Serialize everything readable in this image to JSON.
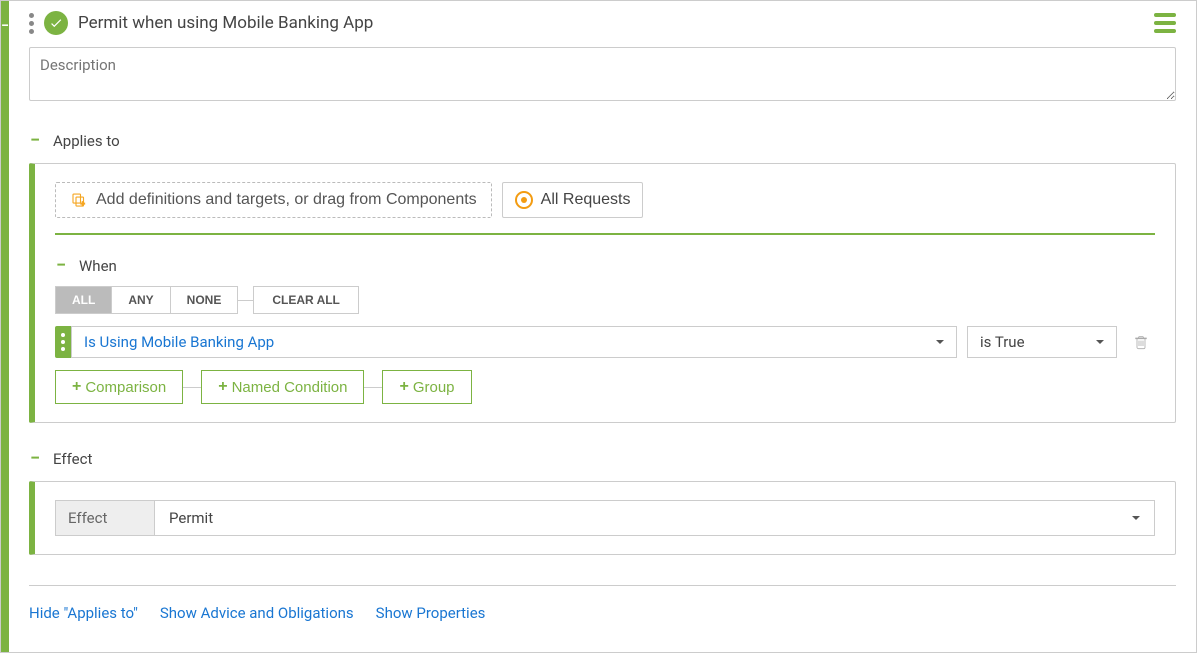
{
  "header": {
    "title": "Permit when using Mobile Banking App",
    "description_placeholder": "Description"
  },
  "applies_to": {
    "title": "Applies to",
    "add_defs_label": "Add definitions and targets, or drag from Components",
    "all_requests_label": "All Requests",
    "when": {
      "title": "When",
      "toggle": {
        "all": "ALL",
        "any": "ANY",
        "none": "NONE",
        "active": "ALL"
      },
      "clear_all_label": "CLEAR ALL",
      "condition": {
        "name": "Is Using Mobile Banking App",
        "value": "is True"
      },
      "add_buttons": {
        "comparison": "Comparison",
        "named_condition": "Named Condition",
        "group": "Group"
      }
    }
  },
  "effect": {
    "title": "Effect",
    "label": "Effect",
    "value": "Permit"
  },
  "footer_links": {
    "hide_applies_to": "Hide \"Applies to\"",
    "show_advice": "Show Advice and Obligations",
    "show_properties": "Show Properties"
  }
}
